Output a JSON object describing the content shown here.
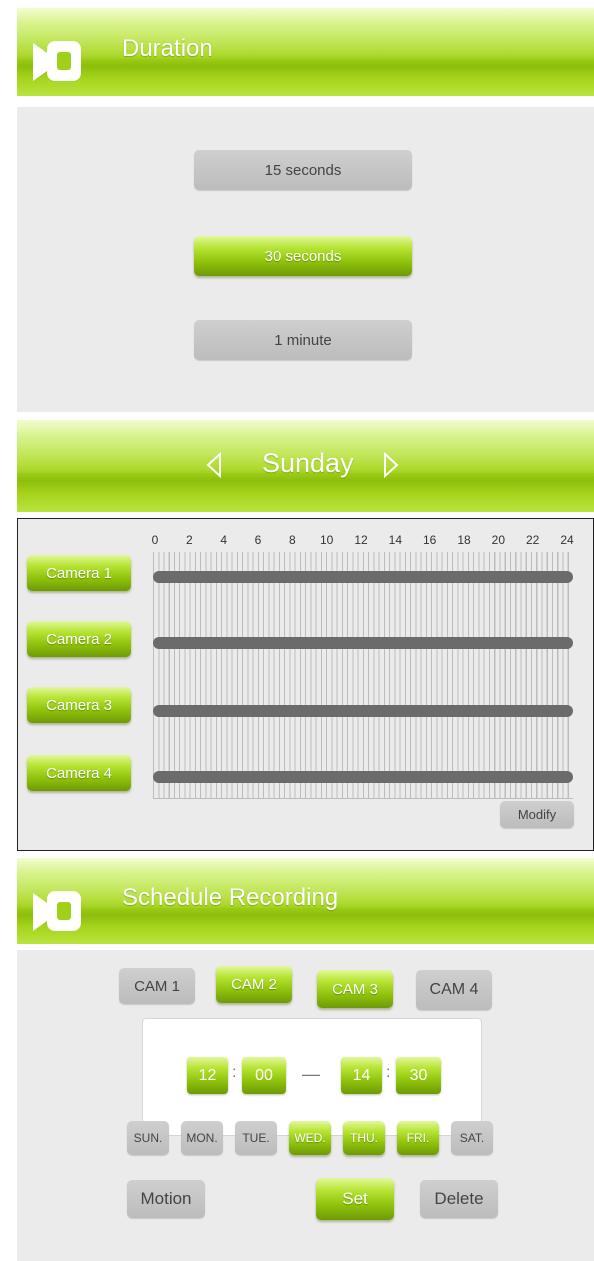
{
  "duration": {
    "title": "Duration",
    "options": [
      {
        "label": "15 seconds",
        "selected": false
      },
      {
        "label": "30 seconds",
        "selected": true
      },
      {
        "label": "1 minute",
        "selected": false
      }
    ]
  },
  "timeline": {
    "day": "Sunday",
    "hour_ticks": [
      "0",
      "2",
      "4",
      "6",
      "8",
      "10",
      "12",
      "14",
      "16",
      "18",
      "20",
      "22",
      "24"
    ],
    "cameras": [
      "Camera 1",
      "Camera 2",
      "Camera 3",
      "Camera 4"
    ],
    "modify_label": "Modify"
  },
  "schedule": {
    "title": "Schedule Recording",
    "cams": [
      {
        "label": "CAM 1",
        "selected": false
      },
      {
        "label": "CAM 2",
        "selected": true
      },
      {
        "label": "CAM 3",
        "selected": true
      },
      {
        "label": "CAM 4",
        "selected": false
      }
    ],
    "start": {
      "hour": "12",
      "minute": "00"
    },
    "end": {
      "hour": "14",
      "minute": "30"
    },
    "time_separator": ":",
    "range_dash": "—",
    "days": [
      {
        "label": "SUN.",
        "selected": false
      },
      {
        "label": "MON.",
        "selected": false
      },
      {
        "label": "TUE.",
        "selected": false
      },
      {
        "label": "WED.",
        "selected": true
      },
      {
        "label": "THU.",
        "selected": true
      },
      {
        "label": "FRI.",
        "selected": true
      },
      {
        "label": "SAT.",
        "selected": false
      }
    ],
    "motion_label": "Motion",
    "set_label": "Set",
    "delete_label": "Delete"
  },
  "colors": {
    "accent_green": "#9fd11a",
    "panel_grey": "#ebebeb",
    "button_grey": "#c4c4c4"
  }
}
